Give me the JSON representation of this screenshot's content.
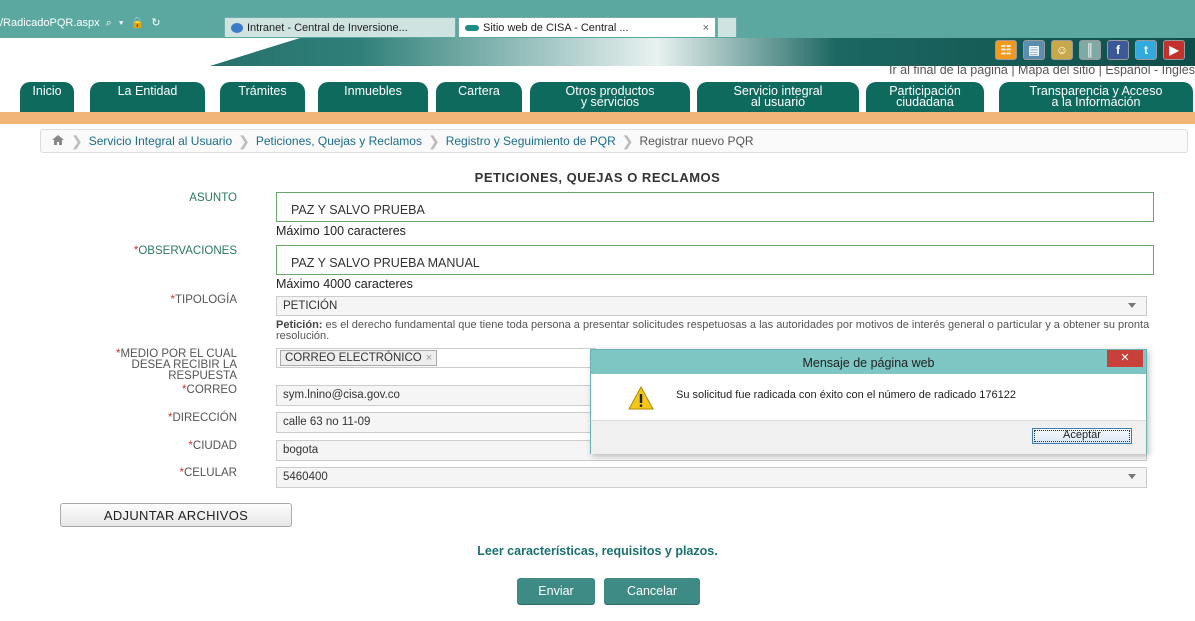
{
  "browser": {
    "address_text": "/RadicadoPQR.aspx",
    "address_tools": "⌕ ▾ 🔒 ↻",
    "tabs": [
      {
        "label": "Intranet - Central de Inversione..."
      },
      {
        "label": "Sitio web de CISA - Central ...",
        "close": "×"
      }
    ]
  },
  "header": {
    "social": [
      {
        "name": "rss",
        "glyph": "☷"
      },
      {
        "name": "mail",
        "glyph": "▤"
      },
      {
        "name": "chat",
        "glyph": "☺"
      },
      {
        "name": "network",
        "glyph": "║"
      },
      {
        "name": "facebook",
        "glyph": "f"
      },
      {
        "name": "twitter",
        "glyph": "t"
      },
      {
        "name": "youtube",
        "glyph": "▶"
      }
    ],
    "top_links": "Ir al final de la página | Mapa del sitio | Español - Inglés"
  },
  "nav": [
    {
      "line1": "Inicio",
      "line2": ""
    },
    {
      "line1": "La Entidad",
      "line2": ""
    },
    {
      "line1": "Trámites",
      "line2": ""
    },
    {
      "line1": "Inmuebles",
      "line2": ""
    },
    {
      "line1": "Cartera",
      "line2": ""
    },
    {
      "line1": "Otros productos",
      "line2": "y servicios"
    },
    {
      "line1": "Servicio integral",
      "line2": "al usuario"
    },
    {
      "line1": "Participación",
      "line2": "ciudadana"
    },
    {
      "line1": "Transparencia y Acceso",
      "line2": "a la Información"
    }
  ],
  "breadcrumb": [
    "Servicio Integral al Usuario",
    "Peticiones, Quejas y Reclamos",
    "Registro y Seguimiento de PQR",
    "Registrar nuevo PQR"
  ],
  "form": {
    "title": "PETICIONES, QUEJAS O RECLAMOS",
    "asunto_label": "ASUNTO",
    "asunto_value": "PAZ Y SALVO PRUEBA",
    "asunto_hint": "Máximo 100 caracteres",
    "obs_label": "OBSERVACIONES",
    "obs_value": "PAZ Y SALVO PRUEBA MANUAL",
    "obs_hint": "Máximo 4000 caracteres",
    "tipologia_label": "TIPOLOGÍA",
    "tipologia_value": "PETICIÓN",
    "tipologia_desc_term": "Petición:",
    "tipologia_desc": "es el derecho fundamental que tiene toda persona a presentar solicitudes respetuosas a las autoridades por motivos de interés general o particular y a obtener su pronta resolución.",
    "medio_label_1": "MEDIO POR EL CUAL",
    "medio_label_2": "DESEA RECIBIR LA",
    "medio_label_3": "RESPUESTA",
    "medio_tag": "CORREO ELECTRÓNICO",
    "medio_tag_remove": "×",
    "correo_label": "CORREO",
    "correo_value": "sym.lnino@cisa.gov.co",
    "direccion_label": "DIRECCIÓN",
    "direccion_value": "calle 63 no 11-09",
    "ciudad_label": "CIUDAD",
    "ciudad_value": "bogota",
    "celular_label": "CELULAR",
    "celular_value": "5460400",
    "required_mark": "*",
    "attach_button": "ADJUNTAR ARCHIVOS",
    "read_link": "Leer características, requisitos y plazos.",
    "send_button": "Enviar",
    "cancel_button": "Cancelar"
  },
  "dialog": {
    "title": "Mensaje de página web",
    "close": "✕",
    "message": "Su solicitud fue radicada con éxito con el número de radicado 176122",
    "ok_button": "Aceptar"
  }
}
